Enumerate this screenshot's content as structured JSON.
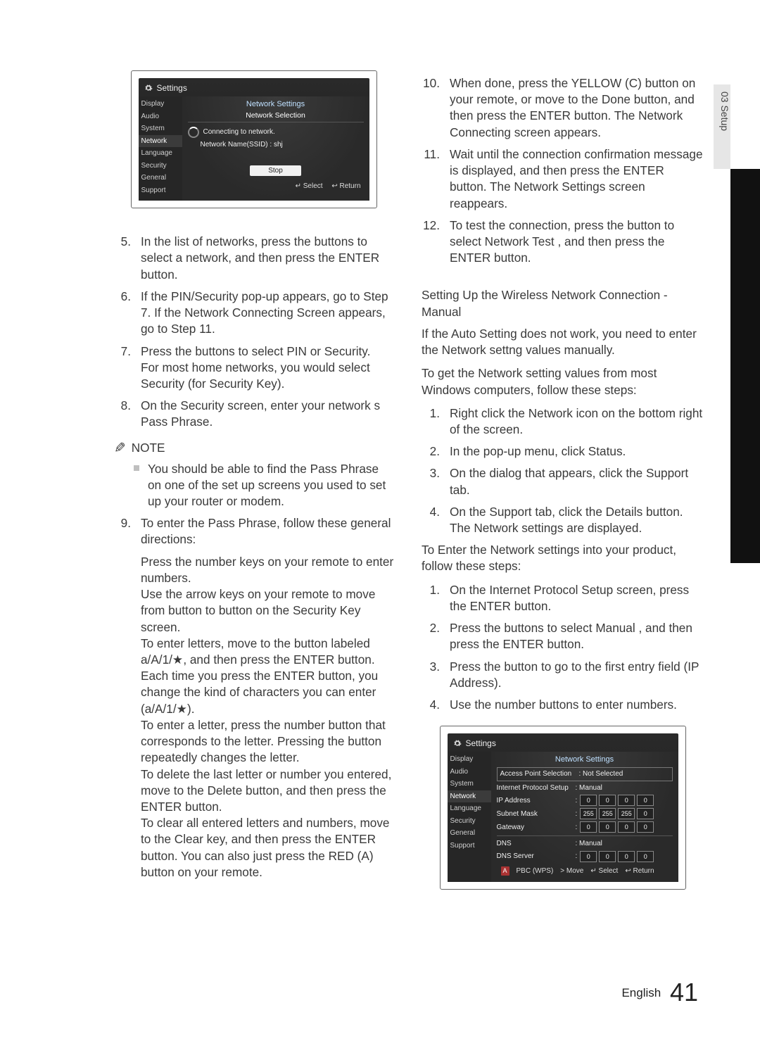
{
  "chapter_tab": "03   Setup",
  "fig1": {
    "title": "Settings",
    "sidebar": [
      "Display",
      "Audio",
      "System",
      "Network",
      "Language",
      "Security",
      "General",
      "Support"
    ],
    "panel_title": "Network Settings",
    "panel_sub": "Network Selection",
    "connecting": "Connecting to network.",
    "ssid": "Network Name(SSID) : shj",
    "stop": "Stop",
    "footer_select": "↵ Select",
    "footer_return": "↩ Return"
  },
  "left": {
    "s5": {
      "n": "5.",
      "t": "In the list of networks, press the   buttons to select a network, and then press the ENTER button."
    },
    "s6": {
      "n": "6.",
      "t": "If the PIN/Security pop-up appears, go to Step 7. If the Network Connecting Screen appears, go to Step 11."
    },
    "s7": {
      "n": "7.",
      "t": "Press the   buttons to select PIN or Security.\nFor most home networks, you would select Security (for Security Key)."
    },
    "s8": {
      "n": "8.",
      "t": "On the Security screen, enter your network s Pass Phrase."
    },
    "note_label": "NOTE",
    "note_text": "You should be able to ﬁnd the Pass Phrase on one of the set up screens you used to set up your router or modem.",
    "s9": {
      "n": "9.",
      "t": "To enter the Pass Phrase, follow these general directions:"
    },
    "s9_body": "Press the number keys on your remote to enter numbers.\nUse the arrow keys on your remote to move from button to button on the Security Key screen.\nTo enter letters, move to the button labeled a/A/1/★, and then press the ENTER button. Each time you press the ENTER button, you change the kind of characters you can enter (a/A/1/★).\nTo enter a letter, press the number button that corresponds to the letter. Pressing the button repeatedly changes the letter.\nTo delete the last letter or number you entered, move to the Delete button, and then press the ENTER button.\nTo clear all entered letters and numbers, move to the Clear key, and then press the ENTER button. You can also just press the RED (A) button on your remote."
  },
  "right": {
    "s10": {
      "n": "10.",
      "t": "When done, press the YELLOW (C) button on your remote, or move to the Done button, and then press the ENTER button. The Network Connecting screen appears."
    },
    "s11": {
      "n": "11.",
      "t": "Wait until the connection conﬁrmation message is displayed, and then press the ENTER button. The Network Settings screen reappears."
    },
    "s12": {
      "n": "12.",
      "t": "To test the connection, press the   button to select Network Test , and then press the ENTER button."
    },
    "heading": "Setting Up the Wireless Network Connection - Manual",
    "p1": "If the Auto Setting does not work, you need to enter the Network settng values manually.",
    "p2": "To get the Network setting values from most Windows computers, follow these steps:",
    "a1": {
      "n": "1.",
      "t": "Right click the Network icon on the bottom right of the screen."
    },
    "a2": {
      "n": "2.",
      "t": "In the pop-up menu, click Status."
    },
    "a3": {
      "n": "3.",
      "t": "On the dialog that appears, click the Support tab."
    },
    "a4": {
      "n": "4.",
      "t": "On the Support tab, click the Details button. The Network settings are displayed."
    },
    "p3": "To Enter the Network settings into your product, follow these steps:",
    "b1": {
      "n": "1.",
      "t": "On the Internet Protocol Setup screen, press the ENTER button."
    },
    "b2": {
      "n": "2.",
      "t": "Press the   buttons to select    Manual , and then press the ENTER button."
    },
    "b3": {
      "n": "3.",
      "t": "Press the   button to go to the ﬁrst entry ﬁeld (IP Address)."
    },
    "b4": {
      "n": "4.",
      "t": "Use the number buttons to enter numbers."
    }
  },
  "fig2": {
    "title": "Settings",
    "sidebar": [
      "Display",
      "Audio",
      "System",
      "Network",
      "Language",
      "Security",
      "General",
      "Support"
    ],
    "panel_title": "Network Settings",
    "ap_label": "Access Point Selection",
    "ap_val": ": Not Selected",
    "ips_label": "Internet Protocol Setup",
    "ips_val": ": Manual",
    "rows": [
      {
        "k": "IP Address",
        "v": [
          "0",
          "0",
          "0",
          "0"
        ]
      },
      {
        "k": "Subnet Mask",
        "v": [
          "255",
          "255",
          "255",
          "0"
        ]
      },
      {
        "k": "Gateway",
        "v": [
          "0",
          "0",
          "0",
          "0"
        ]
      }
    ],
    "dns_label": "DNS",
    "dns_val": ": Manual",
    "dns_server": "DNS Server",
    "dns_values": [
      "0",
      "0",
      "0",
      "0"
    ],
    "footer_pbc": "PBC (WPS)",
    "footer_move": "> Move",
    "footer_select": "↵ Select",
    "footer_return": "↩ Return"
  },
  "footer": {
    "lang": "English",
    "page": "41"
  }
}
